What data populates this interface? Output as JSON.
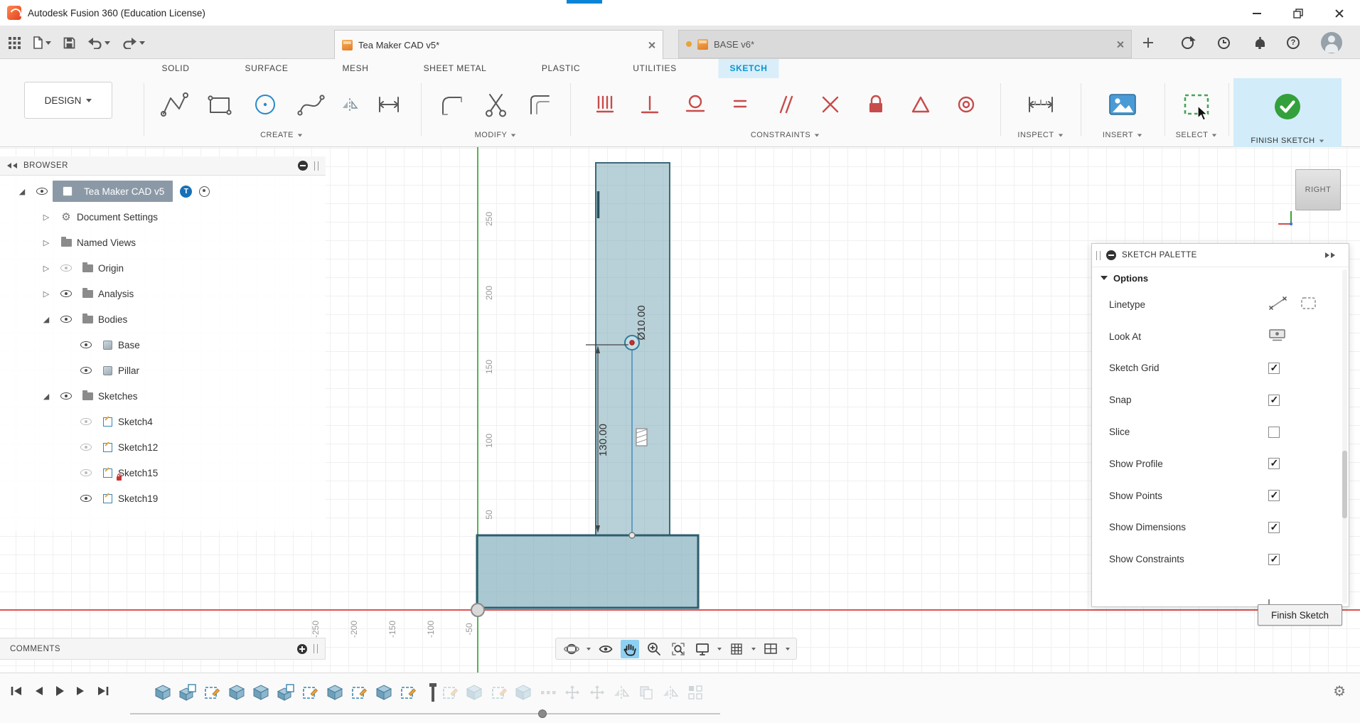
{
  "window": {
    "title": "Autodesk Fusion 360 (Education License)"
  },
  "app_toolbar": {
    "qat_icons": [
      "app-grid",
      "file-menu",
      "save",
      "undo",
      "redo"
    ],
    "tabs": [
      {
        "label": "Tea Maker CAD v5*",
        "active": true,
        "modified": false
      },
      {
        "label": "BASE v6*",
        "active": false,
        "modified": true
      }
    ],
    "right_icons": [
      "sync",
      "history",
      "notifications",
      "help",
      "account"
    ]
  },
  "ribbon": {
    "design_menu": "DESIGN",
    "tabs": [
      "SOLID",
      "SURFACE",
      "MESH",
      "SHEET METAL",
      "PLASTIC",
      "UTILITIES",
      "SKETCH"
    ],
    "active_tab": "SKETCH",
    "groups": [
      {
        "label": "CREATE",
        "icons": [
          "line",
          "rectangle",
          "circle",
          "spline",
          "mirror",
          "dimension"
        ]
      },
      {
        "label": "MODIFY",
        "icons": [
          "fillet",
          "trim",
          "offset"
        ]
      },
      {
        "label": "CONSTRAINTS",
        "icons": [
          "horizontal-vertical",
          "coincident",
          "tangent",
          "equal",
          "parallel",
          "perpendicular",
          "fix",
          "midpoint",
          "concentric"
        ]
      },
      {
        "label": "INSPECT",
        "icons": [
          "measure"
        ]
      },
      {
        "label": "INSERT",
        "icons": [
          "insert-image"
        ]
      },
      {
        "label": "SELECT",
        "icons": [
          "selection-box"
        ]
      },
      {
        "label": "FINISH SKETCH",
        "icons": [
          "finish-check"
        ]
      }
    ]
  },
  "browser": {
    "header": "BROWSER",
    "items": [
      {
        "label": "Tea Maker CAD v5",
        "level": 0,
        "expander": "open",
        "eye": "on",
        "icon": "component",
        "selected": true,
        "badge": "T",
        "target_badge": true
      },
      {
        "label": "Document Settings",
        "level": 1,
        "expander": "closed",
        "eye": null,
        "icon": "gear"
      },
      {
        "label": "Named Views",
        "level": 1,
        "expander": "closed",
        "eye": null,
        "icon": "folder"
      },
      {
        "label": "Origin",
        "level": 1,
        "expander": "closed",
        "eye": "off",
        "icon": "folder"
      },
      {
        "label": "Analysis",
        "level": 1,
        "expander": "closed",
        "eye": "on",
        "icon": "folder"
      },
      {
        "label": "Bodies",
        "level": 1,
        "expander": "open",
        "eye": "on",
        "icon": "folder"
      },
      {
        "label": "Base",
        "level": 2,
        "expander": null,
        "eye": "on",
        "icon": "body"
      },
      {
        "label": "Pillar",
        "level": 2,
        "expander": null,
        "eye": "on",
        "icon": "body"
      },
      {
        "label": "Sketches",
        "level": 1,
        "expander": "open",
        "eye": "on",
        "icon": "folder"
      },
      {
        "label": "Sketch4",
        "level": 2,
        "expander": null,
        "eye": "off",
        "icon": "sketch"
      },
      {
        "label": "Sketch12",
        "level": 2,
        "expander": null,
        "eye": "off",
        "icon": "sketch"
      },
      {
        "label": "Sketch15",
        "level": 2,
        "expander": null,
        "eye": "off",
        "icon": "sketch",
        "locked": true
      },
      {
        "label": "Sketch19",
        "level": 2,
        "expander": null,
        "eye": "on",
        "icon": "sketch"
      }
    ]
  },
  "canvas": {
    "y_axis_labels": [
      "250",
      "200",
      "150",
      "100",
      "50"
    ],
    "x_axis_labels": [
      "-250",
      "-200",
      "-150",
      "-100",
      "-50"
    ],
    "dimensions": {
      "diameter": "Ø10.00",
      "length": "130.00"
    },
    "viewcube": {
      "face": "RIGHT"
    },
    "axis_colors": {
      "x": "#e05252",
      "y": "#58b15a"
    },
    "sketch_fill": "#7daab8"
  },
  "sketch_palette": {
    "title": "SKETCH PALETTE",
    "section": "Options",
    "rows": [
      {
        "label": "Linetype",
        "control": "linetype"
      },
      {
        "label": "Look At",
        "control": "look-at"
      },
      {
        "label": "Sketch Grid",
        "control": "checkbox",
        "checked": true
      },
      {
        "label": "Snap",
        "control": "checkbox",
        "checked": true
      },
      {
        "label": "Slice",
        "control": "checkbox",
        "checked": false
      },
      {
        "label": "Show Profile",
        "control": "checkbox",
        "checked": true
      },
      {
        "label": "Show Points",
        "control": "checkbox",
        "checked": true
      },
      {
        "label": "Show Dimensions",
        "control": "checkbox",
        "checked": true
      },
      {
        "label": "Show Constraints",
        "control": "checkbox",
        "checked": true
      }
    ],
    "finish_button": "Finish Sketch"
  },
  "comments": {
    "label": "COMMENTS"
  },
  "nav_bar": {
    "icons": [
      "orbit",
      "look-at",
      "pan",
      "zoom",
      "fit-view",
      "display-settings",
      "grid-settings",
      "viewports"
    ],
    "active": "pan",
    "carets_after": [
      0,
      5,
      6,
      7
    ]
  },
  "timeline": {
    "playback": [
      "skip-start",
      "step-back",
      "play",
      "step-forward",
      "skip-end"
    ],
    "features": [
      {
        "type": "extrude",
        "state": "active"
      },
      {
        "type": "combo",
        "state": "active"
      },
      {
        "type": "sketch",
        "state": "active"
      },
      {
        "type": "extrude",
        "state": "active"
      },
      {
        "type": "extrude",
        "state": "active"
      },
      {
        "type": "combo",
        "state": "active"
      },
      {
        "type": "sketch",
        "state": "active"
      },
      {
        "type": "extrude",
        "state": "active"
      },
      {
        "type": "sketch",
        "state": "active"
      },
      {
        "type": "extrude",
        "state": "active"
      },
      {
        "type": "sketch",
        "state": "active"
      },
      {
        "type": "playhead"
      },
      {
        "type": "sketch",
        "state": "rolled"
      },
      {
        "type": "extrude",
        "state": "rolled"
      },
      {
        "type": "sketch",
        "state": "rolled"
      },
      {
        "type": "extrude",
        "state": "rolled"
      },
      {
        "type": "dots",
        "state": "rolled"
      },
      {
        "type": "move",
        "state": "rolled"
      },
      {
        "type": "move",
        "state": "rolled"
      },
      {
        "type": "mirror",
        "state": "rolled"
      },
      {
        "type": "paste",
        "state": "rolled"
      },
      {
        "type": "mirror",
        "state": "rolled"
      },
      {
        "type": "pattern",
        "state": "rolled"
      }
    ]
  }
}
